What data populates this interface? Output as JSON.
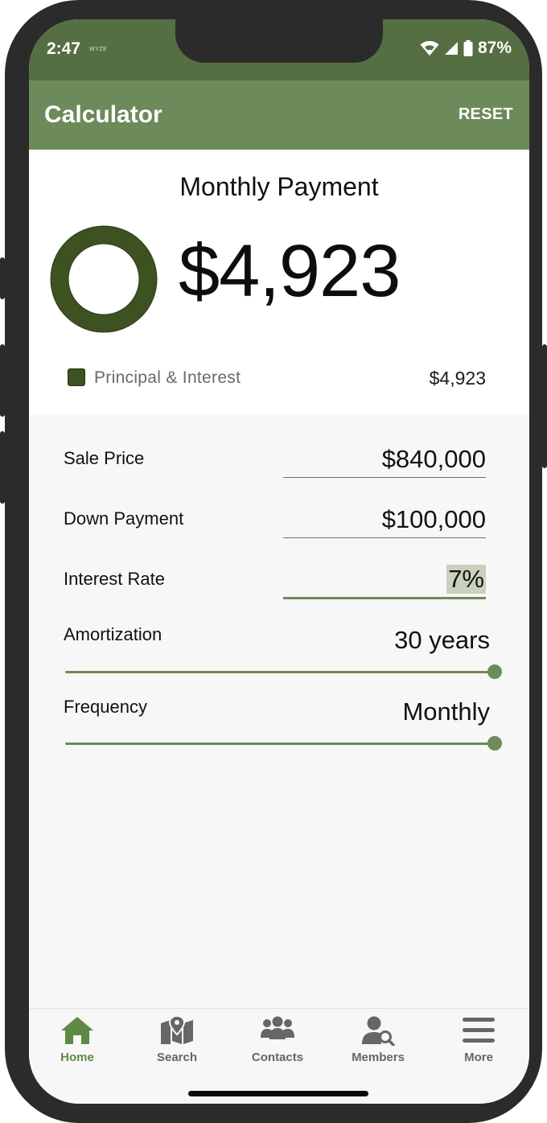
{
  "status_bar": {
    "time": "2:47",
    "brand": "WYZE",
    "battery": "87%"
  },
  "app_bar": {
    "title": "Calculator",
    "reset_label": "RESET"
  },
  "summary": {
    "title": "Monthly Payment",
    "amount": "$4,923",
    "legend": [
      {
        "label": "Principal & Interest",
        "value": "$4,923",
        "color": "#3d5121"
      }
    ]
  },
  "form": {
    "sale_price": {
      "label": "Sale Price",
      "value": "$840,000"
    },
    "down_payment": {
      "label": "Down Payment",
      "value": "$100,000"
    },
    "interest_rate": {
      "label": "Interest Rate",
      "value": "7%"
    },
    "amortization": {
      "label": "Amortization",
      "value": "30 years",
      "slider_fraction": 1.0
    },
    "frequency": {
      "label": "Frequency",
      "value": "Monthly",
      "slider_fraction": 1.0
    }
  },
  "bottom_nav": {
    "items": [
      {
        "label": "Home",
        "icon": "home-icon",
        "active": true
      },
      {
        "label": "Search",
        "icon": "map-icon",
        "active": false
      },
      {
        "label": "Contacts",
        "icon": "contacts-icon",
        "active": false
      },
      {
        "label": "Members",
        "icon": "member-search-icon",
        "active": false
      },
      {
        "label": "More",
        "icon": "menu-icon",
        "active": false
      }
    ]
  },
  "colors": {
    "status_bar": "#566f42",
    "app_bar": "#6c8a5a",
    "accent": "#6c8a5a",
    "donut": "#3d5121",
    "nav_active": "#5d8a45",
    "nav_inactive": "#666666"
  }
}
